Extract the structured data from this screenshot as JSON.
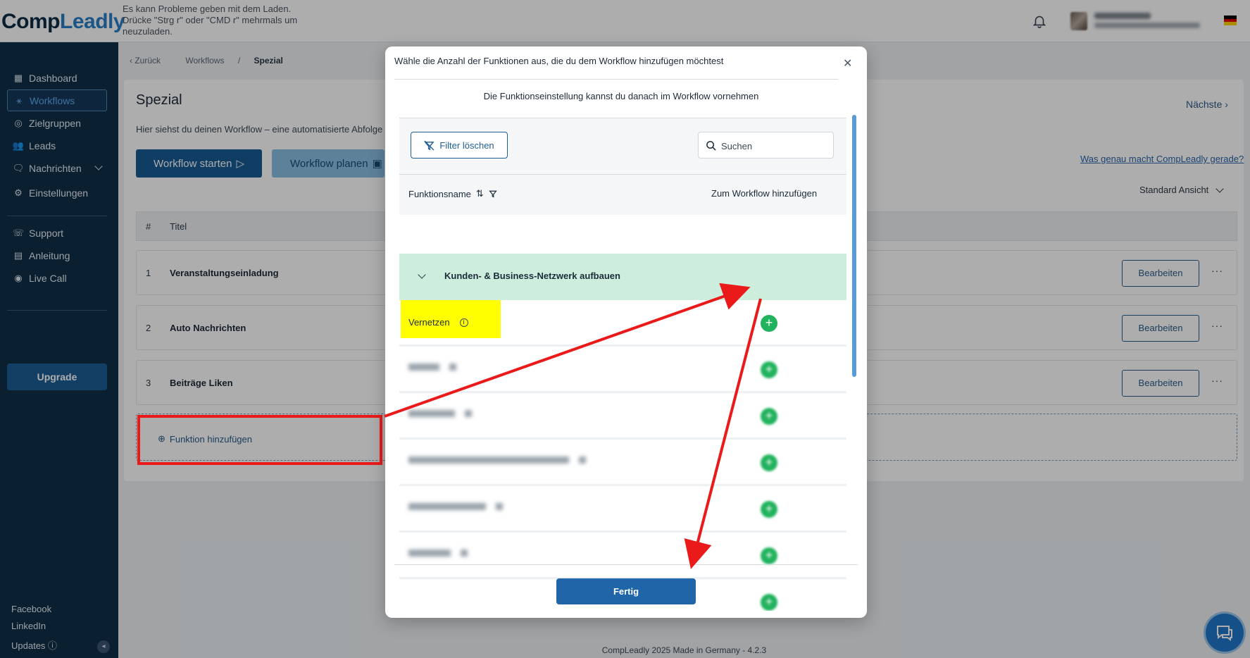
{
  "app": {
    "logo_part1": "Comp",
    "logo_part2": "Leadly",
    "load_warning": "Es kann Probleme geben mit dem Laden. Drücke \"Strg r\" oder \"CMD r\" mehrmals um neuzuladen."
  },
  "sidebar": {
    "items": [
      {
        "label": "Dashboard",
        "icon": "dashboard-icon"
      },
      {
        "label": "Workflows",
        "icon": "workflow-icon",
        "active": true
      },
      {
        "label": "Zielgruppen",
        "icon": "target-icon"
      },
      {
        "label": "Leads",
        "icon": "users-icon"
      },
      {
        "label": "Nachrichten",
        "icon": "messages-icon"
      },
      {
        "label": "Einstellungen",
        "icon": "gear-icon"
      }
    ],
    "support_items": [
      {
        "label": "Support",
        "icon": "support-icon"
      },
      {
        "label": "Anleitung",
        "icon": "book-icon"
      },
      {
        "label": "Live Call",
        "icon": "camera-icon"
      }
    ],
    "upgrade_label": "Upgrade",
    "social": [
      "Facebook",
      "LinkedIn",
      "Updates"
    ]
  },
  "breadcrumb": {
    "back": "Zurück",
    "workflows": "Workflows",
    "current": "Spezial"
  },
  "page": {
    "title": "Spezial",
    "description": "Hier siehst du deinen Workflow – eine automatisierte Abfolge",
    "start_label": "Workflow starten",
    "plan_label": "Workflow planen",
    "next_label": "Nächste",
    "what_link": "Was genau macht CompLeadly gerade?",
    "view_label": "Standard Ansicht"
  },
  "table": {
    "col_num": "#",
    "col_title": "Titel",
    "rows": [
      {
        "num": "1",
        "title": "Veranstaltungseinladung",
        "edit": "Bearbeiten"
      },
      {
        "num": "2",
        "title": "Auto Nachrichten",
        "edit": "Bearbeiten"
      },
      {
        "num": "3",
        "title": "Beiträge Liken",
        "edit": "Bearbeiten"
      }
    ],
    "add_function": "Funktion hinzufügen"
  },
  "footer": "CompLeadly 2025 Made in Germany - 4.2.3",
  "modal": {
    "title": "Wähle die Anzahl der Funktionen aus, die du dem Workflow hinzufügen möchtest",
    "subtitle": "Die Funktionseinstellung kannst du danach im Workflow vornehmen",
    "filter_clear": "Filter löschen",
    "search_placeholder": "Suchen",
    "col_name": "Funktionsname",
    "col_add": "Zum Workflow hinzufügen",
    "group": "Kunden- & Business-Netzwerk aufbauen",
    "first_function": "Vernetzen",
    "done": "Fertig"
  },
  "colors": {
    "sidebar_bg": "#0f2e48",
    "primary": "#195a92",
    "group_bg": "#cdeedd",
    "add_green": "#22b35e",
    "annotation_red": "#ea1a1a",
    "highlight_yellow": "#ffff00"
  }
}
